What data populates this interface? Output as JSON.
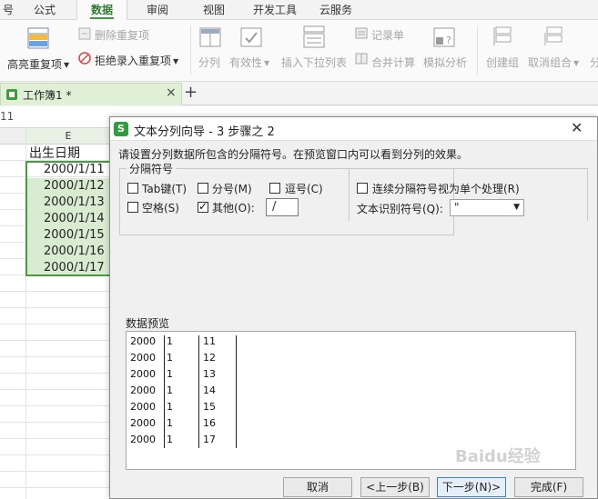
{
  "menu_tabs": [
    "号",
    "公式",
    "数据",
    "审阅",
    "视图",
    "开发工具",
    "云服务"
  ],
  "ribbon": {
    "highlight_dup": "高亮重复项",
    "delete_dup": "删除重复项",
    "reject_dup": "拒绝录入重复项",
    "split": "分列",
    "validity": "有效性",
    "dropdown": "插入下拉列表",
    "record": "记录单",
    "consolidate": "合并计算",
    "simulate": "模拟分析",
    "group": "创建组",
    "ungroup": "取消组合",
    "cut_label": "分"
  },
  "workbook": {
    "tab_label": "工作簿1 *",
    "close": "×",
    "add": "+"
  },
  "formula_bar": {
    "ref": "11"
  },
  "sheet": {
    "column_header": "E",
    "header_cell": "出生日期",
    "dates": [
      "2000/1/11",
      "2000/1/12",
      "2000/1/13",
      "2000/1/14",
      "2000/1/15",
      "2000/1/16",
      "2000/1/17"
    ]
  },
  "dialog": {
    "title": "文本分列向导 - 3 步骤之 2",
    "app_icon": "S",
    "close": "✕",
    "instruction": "请设置分列数据所包含的分隔符号。在预览窗口内可以看到分列的效果。",
    "group_title": "分隔符号",
    "delimiters": {
      "tab": "Tab键(T)",
      "semicolon": "分号(M)",
      "comma": "逗号(C)",
      "space": "空格(S)",
      "other": "其他(O):"
    },
    "other_value": "/",
    "consecutive": "连续分隔符号视为单个处理(R)",
    "qualifier_label": "文本识别符号(Q):",
    "qualifier_value": "\"",
    "preview_label": "数据预览",
    "preview_rows": [
      [
        "2000",
        "1",
        "11"
      ],
      [
        "2000",
        "1",
        "12"
      ],
      [
        "2000",
        "1",
        "13"
      ],
      [
        "2000",
        "1",
        "14"
      ],
      [
        "2000",
        "1",
        "15"
      ],
      [
        "2000",
        "1",
        "16"
      ],
      [
        "2000",
        "1",
        "17"
      ]
    ],
    "buttons": {
      "cancel": "取消",
      "back": "<上一步(B)",
      "next": "下一步(N)>",
      "finish": "完成(F)"
    }
  },
  "watermark": "Baidu经验",
  "colors": {
    "accent": "#3d9c3f",
    "selection": "#d9ecd1",
    "dialog_icon": "#2e9d3c"
  },
  "icons": [
    "highlight-duplicates-icon",
    "delete-duplicates-icon",
    "reject-duplicates-icon",
    "split-column-icon",
    "validity-icon",
    "dropdown-list-icon",
    "record-form-icon",
    "consolidate-icon",
    "what-if-icon",
    "group-icon",
    "ungroup-icon",
    "sheet-icon",
    "dialog-app-icon"
  ]
}
